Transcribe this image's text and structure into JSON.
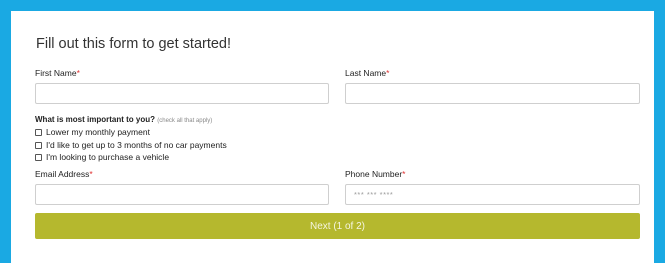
{
  "form": {
    "title": "Fill out this form to get started!",
    "required_mark": "*",
    "first_name": {
      "label": "First Name",
      "value": ""
    },
    "last_name": {
      "label": "Last Name",
      "value": ""
    },
    "important": {
      "question": "What is most important to you?",
      "hint": "(check all that apply)",
      "options": [
        {
          "label": "Lower my monthly payment",
          "checked": false
        },
        {
          "label": "I'd like to get up to 3 months of no car payments",
          "checked": false
        },
        {
          "label": "I'm looking to purchase a vehicle",
          "checked": false
        }
      ]
    },
    "email": {
      "label": "Email Address",
      "value": ""
    },
    "phone": {
      "label": "Phone Number",
      "placeholder": "*** *** ****",
      "value": ""
    },
    "next_button": "Next (1 of 2)"
  },
  "colors": {
    "frame": "#1aa9e3",
    "button": "#b5b82e",
    "required": "#e03131"
  }
}
